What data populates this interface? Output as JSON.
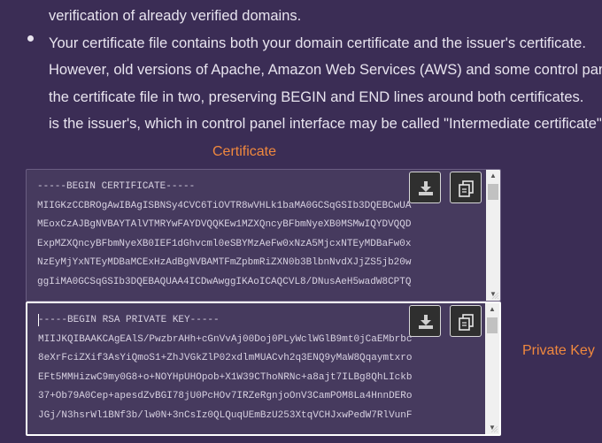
{
  "instructions": {
    "line1": "verification of already verified domains.",
    "line2": "Your certificate file contains both your domain certificate and the issuer's certificate.",
    "line3": "However, old versions of Apache, Amazon Web Services (AWS) and some control panels",
    "line4": "the certificate file in two, preserving BEGIN and END lines around both certificates.",
    "line5": "is the issuer's, which in control panel interface may be called \"Intermediate certificate\"."
  },
  "certificate": {
    "label": "Certificate",
    "lines": [
      "-----BEGIN CERTIFICATE-----",
      "MIIGKzCCBROgAwIBAgISBNSy4CVC6TiOVTR8wVHLk1baMA0GCSqGSIb3DQEBCwUA",
      "MEoxCzAJBgNVBAYTAlVTMRYwFAYDVQQKEw1MZXQncyBFbmNyeXB0MSMwIQYDVQQD",
      "ExpMZXQncyBFbmNyeXB0IEF1dGhvcml0eSBYMzAeFw0xNzA5MjcxNTEyMDBaFw0x",
      "NzEyMjYxNTEyMDBaMCExHzAdBgNVBAMTFmZpbmRiZXN0b3BlbnNvdXJjZS5jb20w",
      "ggIiMA0GCSqGSIb3DQEBAQUAA4ICDwAwggIKAoICAQCVL8/DNusAeH5wadW8CPTQ"
    ]
  },
  "private_key": {
    "label": "Private Key",
    "lines": [
      "-----BEGIN RSA PRIVATE KEY-----",
      "MIIJKQIBAAKCAgEAlS/PwzbrAHh+cGnVvAj00Doj0PLyWclWGlB9mt0jCaEMbrbc",
      "8eXrFciZXif3AsYiQmoS1+ZhJVGkZlP02xdlmMUACvh2q3ENQ9yMaW8Qqaymtxro",
      "EFt5MMHizwC9my0G8+o+NOYHpUHOpob+X1W39CThoNRNc+a8ajt7ILBg8QhLIckb",
      "37+Ob79A0Cep+apesdZvBGI78jU0PcHOv7IRZeRgnjoOnV3CamPOM8La4HnnDERo",
      "JGj/N3hsrWl1BNf3b/lw0N+3nCsIz0QLQuqUEmBzU253XtqVCHJxwPedW7RlVunF"
    ]
  },
  "icons": {
    "download": "download-icon",
    "copy": "copy-icon"
  },
  "colors": {
    "background": "#3b2d55",
    "accent": "#f0883e"
  }
}
